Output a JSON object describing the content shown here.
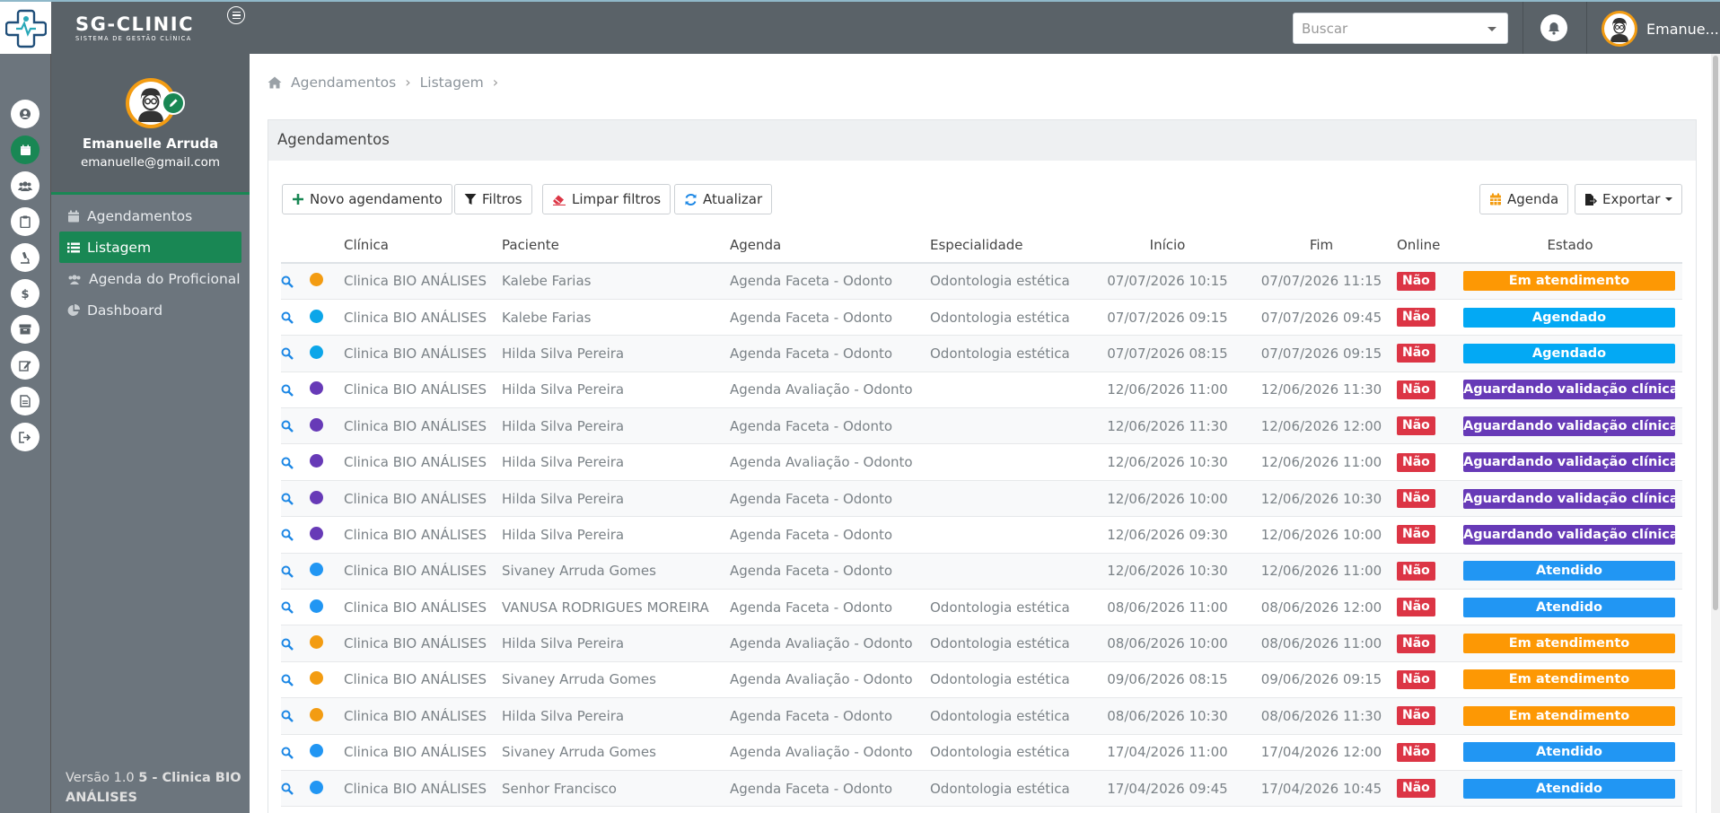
{
  "brand": {
    "title": "SG-CLINIC",
    "subtitle": "SISTEMA DE GESTÃO CLÍNICA"
  },
  "header": {
    "search_placeholder": "Buscar",
    "user_name": "Emanue..."
  },
  "profile": {
    "name": "Emanuelle Arruda",
    "email": "emanuelle@gmail.com"
  },
  "sidebar": {
    "items": [
      {
        "label": "Agendamentos",
        "icon": "calendar-icon",
        "active": false
      },
      {
        "label": "Listagem",
        "icon": "list-icon",
        "active": true
      },
      {
        "label": "Agenda do Proficional",
        "icon": "users-icon",
        "active": false
      },
      {
        "label": "Dashboard",
        "icon": "pie-chart-icon",
        "active": false
      }
    ],
    "version_prefix": "Versão 1.0 ",
    "version_clinic": "5 - Clinica BIO ANÁLISES"
  },
  "breadcrumb": {
    "items": [
      "Agendamentos",
      "Listagem"
    ]
  },
  "card": {
    "title": "Agendamentos"
  },
  "toolbar": {
    "new_label": "Novo agendamento",
    "filters_label": "Filtros",
    "clear_label": "Limpar filtros",
    "refresh_label": "Atualizar",
    "agenda_label": "Agenda",
    "export_label": "Exportar"
  },
  "table": {
    "headers": {
      "clinica": "Clínica",
      "paciente": "Paciente",
      "agenda": "Agenda",
      "especialidade": "Especialidade",
      "inicio": "Início",
      "fim": "Fim",
      "online": "Online",
      "estado": "Estado"
    },
    "rows": [
      {
        "dot": "#f39c12",
        "clinica": "Clinica BIO ANÁLISES",
        "paciente": "Kalebe Farias",
        "agenda": "Agenda Faceta - Odonto",
        "especialidade": "Odontologia estética",
        "inicio": "07/07/2026 10:15",
        "fim": "07/07/2026 11:15",
        "online": "Não",
        "estado": "Em atendimento",
        "estado_color": "#fd9804"
      },
      {
        "dot": "#0ca6e9",
        "clinica": "Clinica BIO ANÁLISES",
        "paciente": "Kalebe Farias",
        "agenda": "Agenda Faceta - Odonto",
        "especialidade": "Odontologia estética",
        "inicio": "07/07/2026 09:15",
        "fim": "07/07/2026 09:45",
        "online": "Não",
        "estado": "Agendado",
        "estado_color": "#03a9f4"
      },
      {
        "dot": "#0ca6e9",
        "clinica": "Clinica BIO ANÁLISES",
        "paciente": "Hilda Silva Pereira",
        "agenda": "Agenda Faceta - Odonto",
        "especialidade": "Odontologia estética",
        "inicio": "07/07/2026 08:15",
        "fim": "07/07/2026 09:15",
        "online": "Não",
        "estado": "Agendado",
        "estado_color": "#03a9f4"
      },
      {
        "dot": "#673ab7",
        "clinica": "Clinica BIO ANÁLISES",
        "paciente": "Hilda Silva Pereira",
        "agenda": "Agenda Avaliação - Odonto",
        "especialidade": "",
        "inicio": "12/06/2026 11:00",
        "fim": "12/06/2026 11:30",
        "online": "Não",
        "estado": "Aguardando validação clínica",
        "estado_color": "#673ab7"
      },
      {
        "dot": "#673ab7",
        "clinica": "Clinica BIO ANÁLISES",
        "paciente": "Hilda Silva Pereira",
        "agenda": "Agenda Faceta - Odonto",
        "especialidade": "",
        "inicio": "12/06/2026 11:30",
        "fim": "12/06/2026 12:00",
        "online": "Não",
        "estado": "Aguardando validação clínica",
        "estado_color": "#673ab7"
      },
      {
        "dot": "#673ab7",
        "clinica": "Clinica BIO ANÁLISES",
        "paciente": "Hilda Silva Pereira",
        "agenda": "Agenda Avaliação - Odonto",
        "especialidade": "",
        "inicio": "12/06/2026 10:30",
        "fim": "12/06/2026 11:00",
        "online": "Não",
        "estado": "Aguardando validação clínica",
        "estado_color": "#673ab7"
      },
      {
        "dot": "#673ab7",
        "clinica": "Clinica BIO ANÁLISES",
        "paciente": "Hilda Silva Pereira",
        "agenda": "Agenda Faceta - Odonto",
        "especialidade": "",
        "inicio": "12/06/2026 10:00",
        "fim": "12/06/2026 10:30",
        "online": "Não",
        "estado": "Aguardando validação clínica",
        "estado_color": "#673ab7"
      },
      {
        "dot": "#673ab7",
        "clinica": "Clinica BIO ANÁLISES",
        "paciente": "Hilda Silva Pereira",
        "agenda": "Agenda Faceta - Odonto",
        "especialidade": "",
        "inicio": "12/06/2026 09:30",
        "fim": "12/06/2026 10:00",
        "online": "Não",
        "estado": "Aguardando validação clínica",
        "estado_color": "#673ab7"
      },
      {
        "dot": "#2196f3",
        "clinica": "Clinica BIO ANÁLISES",
        "paciente": "Sivaney Arruda Gomes",
        "agenda": "Agenda Faceta - Odonto",
        "especialidade": "",
        "inicio": "12/06/2026 10:30",
        "fim": "12/06/2026 11:00",
        "online": "Não",
        "estado": "Atendido",
        "estado_color": "#2196f3"
      },
      {
        "dot": "#2196f3",
        "clinica": "Clinica BIO ANÁLISES",
        "paciente": "VANUSA RODRIGUES MOREIRA",
        "agenda": "Agenda Faceta - Odonto",
        "especialidade": "Odontologia estética",
        "inicio": "08/06/2026 11:00",
        "fim": "08/06/2026 12:00",
        "online": "Não",
        "estado": "Atendido",
        "estado_color": "#2196f3"
      },
      {
        "dot": "#f39c12",
        "clinica": "Clinica BIO ANÁLISES",
        "paciente": "Hilda Silva Pereira",
        "agenda": "Agenda Avaliação - Odonto",
        "especialidade": "Odontologia estética",
        "inicio": "08/06/2026 10:00",
        "fim": "08/06/2026 11:00",
        "online": "Não",
        "estado": "Em atendimento",
        "estado_color": "#fd9804"
      },
      {
        "dot": "#f39c12",
        "clinica": "Clinica BIO ANÁLISES",
        "paciente": "Sivaney Arruda Gomes",
        "agenda": "Agenda Avaliação - Odonto",
        "especialidade": "Odontologia estética",
        "inicio": "09/06/2026 08:15",
        "fim": "09/06/2026 09:15",
        "online": "Não",
        "estado": "Em atendimento",
        "estado_color": "#fd9804"
      },
      {
        "dot": "#f39c12",
        "clinica": "Clinica BIO ANÁLISES",
        "paciente": "Hilda Silva Pereira",
        "agenda": "Agenda Faceta - Odonto",
        "especialidade": "Odontologia estética",
        "inicio": "08/06/2026 10:30",
        "fim": "08/06/2026 11:30",
        "online": "Não",
        "estado": "Em atendimento",
        "estado_color": "#fd9804"
      },
      {
        "dot": "#2196f3",
        "clinica": "Clinica BIO ANÁLISES",
        "paciente": "Sivaney Arruda Gomes",
        "agenda": "Agenda Avaliação - Odonto",
        "especialidade": "Odontologia estética",
        "inicio": "17/04/2026 11:00",
        "fim": "17/04/2026 12:00",
        "online": "Não",
        "estado": "Atendido",
        "estado_color": "#2196f3"
      },
      {
        "dot": "#2196f3",
        "clinica": "Clinica BIO ANÁLISES",
        "paciente": "Senhor Francisco",
        "agenda": "Agenda Faceta - Odonto",
        "especialidade": "Odontologia estética",
        "inicio": "17/04/2026 09:45",
        "fim": "17/04/2026 10:45",
        "online": "Não",
        "estado": "Atendido",
        "estado_color": "#2196f3"
      }
    ]
  }
}
